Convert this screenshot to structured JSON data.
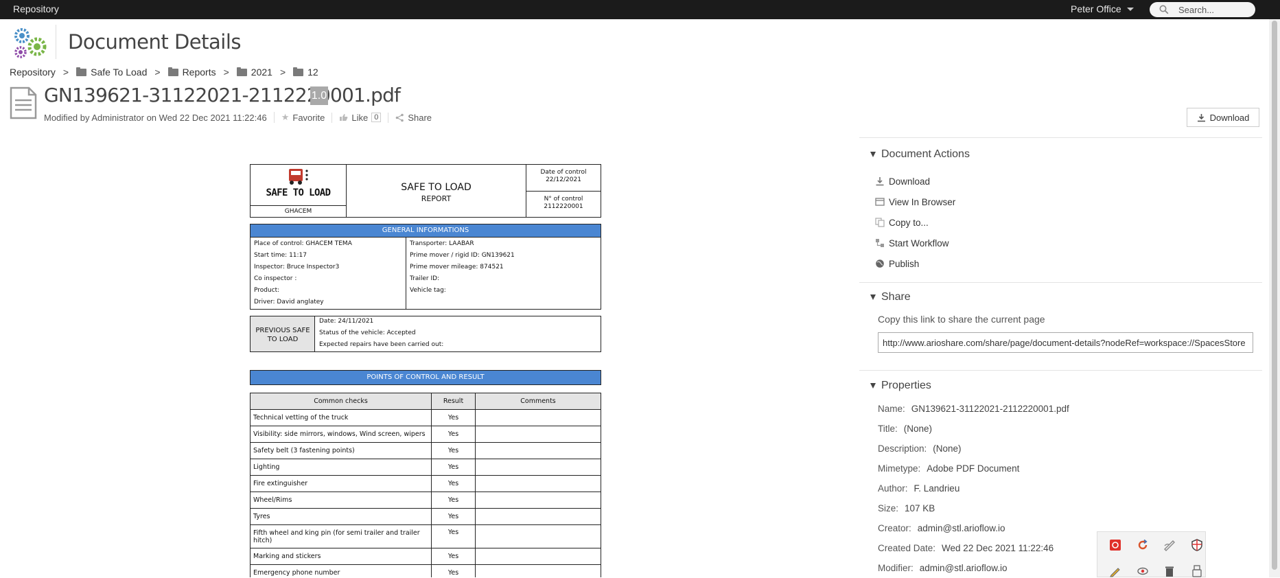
{
  "topbar": {
    "repository": "Repository",
    "user": "Peter Office",
    "search_placeholder": "Search..."
  },
  "header": {
    "title": "Document Details"
  },
  "breadcrumb": [
    "Repository",
    "Safe To Load",
    "Reports",
    "2021",
    "12"
  ],
  "document": {
    "filename": "GN139621-31122021-2112220001.pdf",
    "version": "1.0",
    "modified": "Modified by Administrator on Wed 22 Dec 2021 11:22:46",
    "favorite": "Favorite",
    "like": "Like",
    "like_count": "0",
    "share": "Share",
    "download": "Download"
  },
  "pdf": {
    "brand": "SAFE TO LOAD",
    "site": "GHACEM",
    "title": "SAFE TO LOAD",
    "subtitle": "REPORT",
    "date_label": "Date of control",
    "date_value": "22/12/2021",
    "num_label": "N° of control",
    "num_value": "2112220001",
    "general_header": "GENERAL INFORMATIONS",
    "left_info": [
      "Place of control: GHACEM TEMA",
      "Start time: 11:17",
      "Inspector: Bruce Inspector3",
      "Co inspector :",
      "Product:",
      "Driver:  David anglatey"
    ],
    "right_info": [
      "Transporter: LAABAR",
      "Prime mover / rigid ID: GN139621",
      "Prime mover mileage: 874521",
      "Trailer ID:",
      "Vehicle tag:"
    ],
    "previous_label": "PREVIOUS SAFE TO LOAD",
    "previous_lines": [
      "Date: 24/11/2021",
      "Status of the vehicle: Accepted",
      "Expected repairs have been carried out:"
    ],
    "points_header": "POINTS OF CONTROL AND RESULT",
    "table_headers": [
      "Common checks",
      "Result",
      "Comments"
    ],
    "table_rows": [
      [
        "Technical vetting of the truck",
        "Yes",
        ""
      ],
      [
        "Visibility: side mirrors, windows, Wind screen, wipers",
        "Yes",
        ""
      ],
      [
        "Safety belt (3 fastening points)",
        "Yes",
        ""
      ],
      [
        "Lighting",
        "Yes",
        ""
      ],
      [
        "Fire extinguisher",
        "Yes",
        ""
      ],
      [
        "Wheel/Rims",
        "Yes",
        ""
      ],
      [
        "Tyres",
        "Yes",
        ""
      ],
      [
        "Fifth wheel and king pin (for semi trailer and trailer hitch)",
        "Yes",
        ""
      ],
      [
        "Marking and stickers",
        "Yes",
        ""
      ],
      [
        "Emergency phone number",
        "Yes",
        ""
      ]
    ]
  },
  "panel": {
    "actions_title": "Document Actions",
    "actions": [
      "Download",
      "View In Browser",
      "Copy to...",
      "Start Workflow",
      "Publish"
    ],
    "share_title": "Share",
    "share_label": "Copy this link to share the current page",
    "share_url": "http://www.arioshare.com/share/page/document-details?nodeRef=workspace://SpacesStore",
    "properties_title": "Properties",
    "properties": [
      {
        "label": "Name:",
        "value": "GN139621-31122021-2112220001.pdf"
      },
      {
        "label": "Title:",
        "value": "(None)"
      },
      {
        "label": "Description:",
        "value": "(None)"
      },
      {
        "label": "Mimetype:",
        "value": "Adobe PDF Document"
      },
      {
        "label": "Author:",
        "value": "F. Landrieu"
      },
      {
        "label": "Size:",
        "value": "107 KB"
      },
      {
        "label": "Creator:",
        "value": "admin@stl.arioflow.io"
      },
      {
        "label": "Created Date:",
        "value": "Wed 22 Dec 2021 11:22:46"
      },
      {
        "label": "Modifier:",
        "value": "admin@stl.arioflow.io"
      }
    ]
  },
  "colors": {
    "topbar": "#1b1b1b",
    "pdf_blue": "#4a86d2",
    "version_badge": "#a9a9a9"
  }
}
